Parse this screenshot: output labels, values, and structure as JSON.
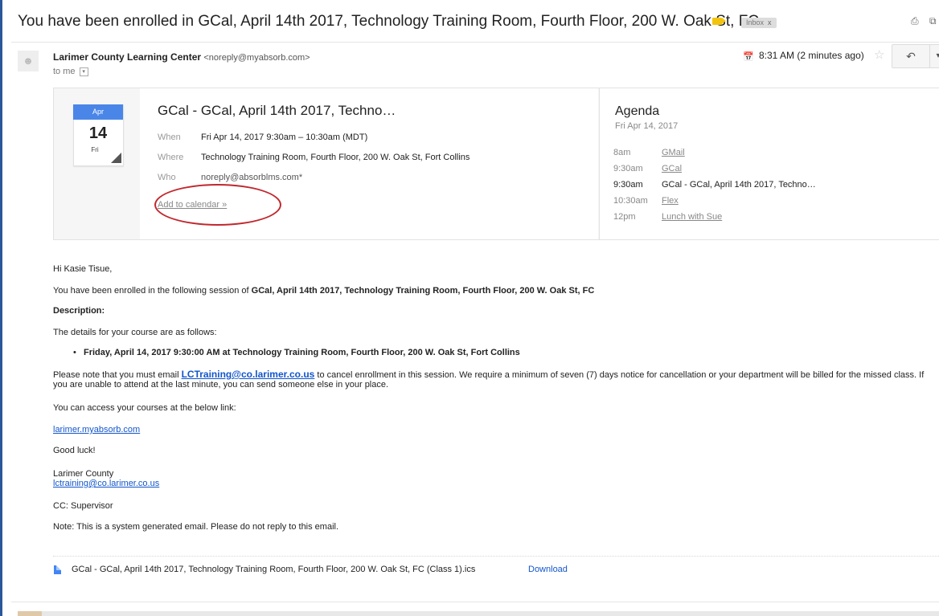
{
  "subject": "You have been enrolled in GCal, April 14th 2017, Technology Training Room, Fourth Floor, 200 W. Oak St, FC",
  "label_chip": {
    "text": "Inbox",
    "close": "x"
  },
  "header_icons": {
    "print": "print-icon",
    "new_window": "new-window-icon"
  },
  "sender": {
    "name": "Larimer County Learning Center",
    "email": "<noreply@myabsorb.com>",
    "to": "to me",
    "time": "8:31 AM (2 minutes ago)",
    "avatar_icon": "person-icon"
  },
  "invite": {
    "month": "Apr",
    "day": "14",
    "dow": "Fri",
    "title": "GCal - GCal, April 14th 2017, Techno…",
    "when_label": "When",
    "when": "Fri Apr 14, 2017 9:30am – 10:30am (MDT)",
    "where_label": "Where",
    "where": "Technology Training Room, Fourth Floor, 200 W. Oak St, Fort Collins",
    "who_label": "Who",
    "who": "noreply@absorblms.com*",
    "add_to_calendar": "Add to calendar »"
  },
  "agenda": {
    "title": "Agenda",
    "date": "Fri Apr 14, 2017",
    "items": [
      {
        "time": "8am",
        "event": "GMail"
      },
      {
        "time": "9:30am",
        "event": "GCal"
      },
      {
        "time": "9:30am",
        "event": "GCal - GCal, April 14th 2017, Techno…"
      },
      {
        "time": "10:30am",
        "event": "Flex"
      },
      {
        "time": "12pm",
        "event": "Lunch with Sue"
      }
    ]
  },
  "body": {
    "greeting": "Hi Kasie Tisue,",
    "enrolled_prefix": "You have been enrolled in the following session of ",
    "enrolled_session": "GCal, April 14th 2017, Technology Training Room, Fourth Floor, 200 W. Oak St, FC",
    "description_label": "Description:",
    "details_intro": "The details for your course are as follows:",
    "bullet": "Friday, April 14, 2017 9:30:00 AM at Technology Training Room, Fourth Floor, 200 W. Oak St, Fort Collins",
    "note_prefix": "Please note that you must email ",
    "note_email": "LCTraining@co.larimer.co.us",
    "note_suffix": " to cancel enrollment in this session. We require a minimum of seven (7) days notice for cancellation or your department will be billed for the missed class. If you are unable to attend at the last minute, you can send someone else in your place.",
    "access_text": "You can access your courses at the below link:",
    "access_link": "larimer.myabsorb.com",
    "good_luck": "Good luck!",
    "sig_org": "Larimer County",
    "sig_email": "lctraining@co.larimer.co.us",
    "cc": "CC: Supervisor",
    "note_system": "Note: This is a system generated email. Please do not reply to this email."
  },
  "attachment": {
    "name": "GCal - GCal, April 14th 2017, Technology Training Room, Fourth Floor, 200 W. Oak St, FC (Class 1).ics",
    "download": "Download"
  },
  "colors": {
    "calendar_blue": "#4a86e8",
    "link": "#1155cc",
    "annotation_red": "#c0282e",
    "label_yellow": "#f2c40e"
  }
}
